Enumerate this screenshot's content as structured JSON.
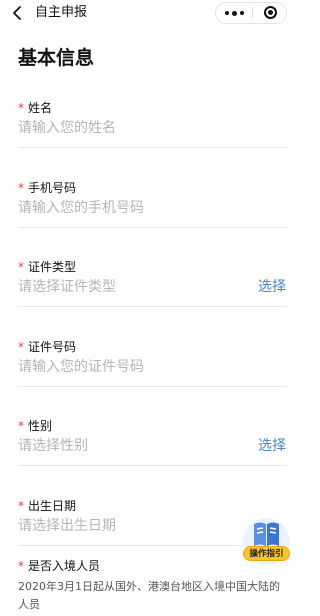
{
  "header": {
    "title": "自主申报",
    "icons": {
      "back": "chevron-left-icon",
      "more": "more-dots-icon",
      "close": "target-circle-icon"
    }
  },
  "page_title": "基本信息",
  "required_mark": "*",
  "fields": [
    {
      "label": "姓名",
      "placeholder": "请输入您的姓名"
    },
    {
      "label": "手机号码",
      "placeholder": "请输入您的手机号码"
    },
    {
      "label": "证件类型",
      "placeholder": "请选择证件类型",
      "action": "选择"
    },
    {
      "label": "证件号码",
      "placeholder": "请输入您的证件号码"
    },
    {
      "label": "性别",
      "placeholder": "请选择性别",
      "action": "选择"
    },
    {
      "label": "出生日期",
      "placeholder": "请选择出生日期"
    }
  ],
  "entry": {
    "label": "是否入境人员",
    "description": "2020年3月1日起从国外、港澳台地区入境中国大陆的人员"
  },
  "guide": {
    "label": "操作指引",
    "icon": "guide-book-icon"
  },
  "colors": {
    "required": "#e5443d",
    "link": "#4a86c4",
    "placeholder": "#b5b5b5",
    "guide_tag": "#f7c52e"
  }
}
